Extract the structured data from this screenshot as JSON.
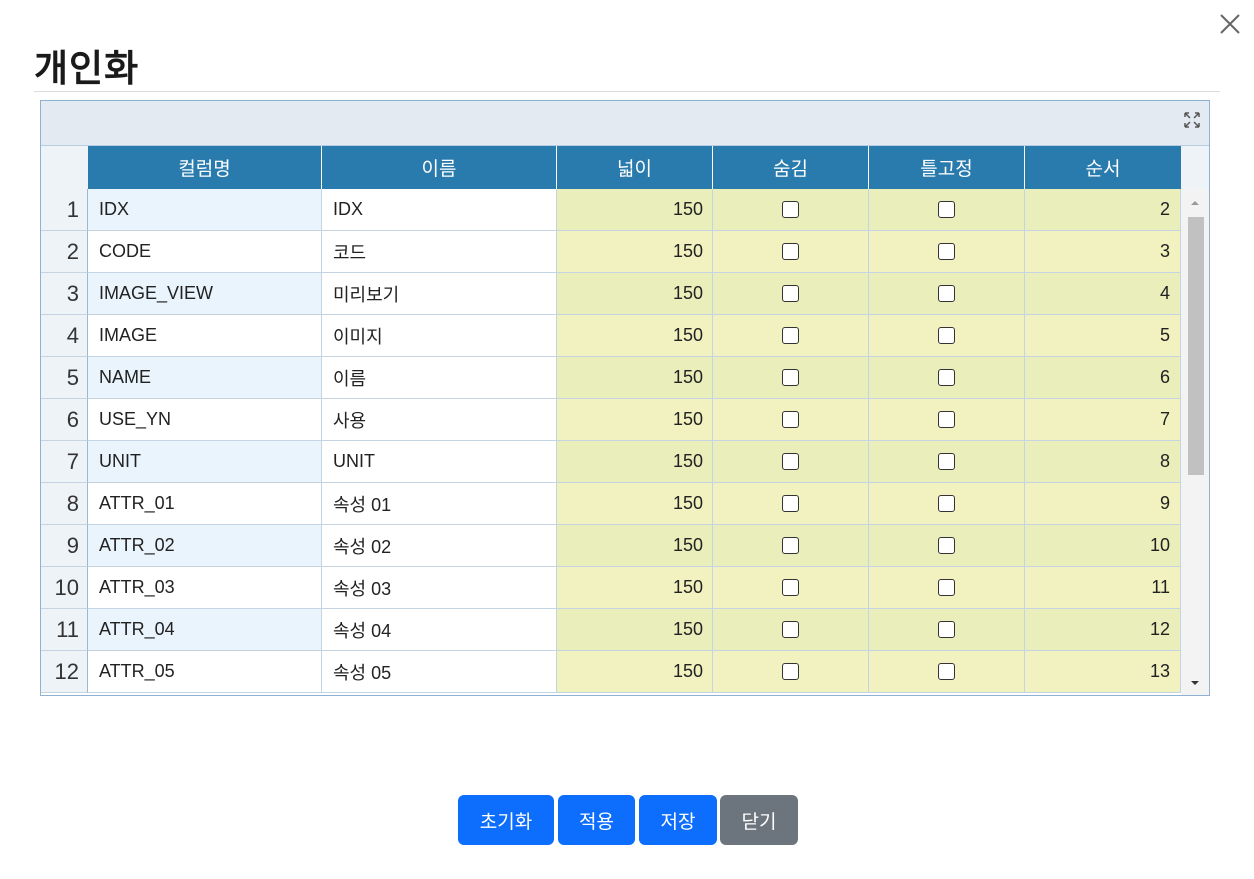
{
  "dialog": {
    "title": "개인화"
  },
  "grid": {
    "columns": [
      "컬럼명",
      "이름",
      "넓이",
      "숨김",
      "틀고정",
      "순서"
    ],
    "rows": [
      {
        "num": "1",
        "column": "IDX",
        "name": "IDX",
        "width": "150",
        "hidden": false,
        "frozen": false,
        "order": "2"
      },
      {
        "num": "2",
        "column": "CODE",
        "name": "코드",
        "width": "150",
        "hidden": false,
        "frozen": false,
        "order": "3"
      },
      {
        "num": "3",
        "column": "IMAGE_VIEW",
        "name": "미리보기",
        "width": "150",
        "hidden": false,
        "frozen": false,
        "order": "4"
      },
      {
        "num": "4",
        "column": "IMAGE",
        "name": "이미지",
        "width": "150",
        "hidden": false,
        "frozen": false,
        "order": "5"
      },
      {
        "num": "5",
        "column": "NAME",
        "name": "이름",
        "width": "150",
        "hidden": false,
        "frozen": false,
        "order": "6"
      },
      {
        "num": "6",
        "column": "USE_YN",
        "name": "사용",
        "width": "150",
        "hidden": false,
        "frozen": false,
        "order": "7"
      },
      {
        "num": "7",
        "column": "UNIT",
        "name": "UNIT",
        "width": "150",
        "hidden": false,
        "frozen": false,
        "order": "8"
      },
      {
        "num": "8",
        "column": "ATTR_01",
        "name": "속성 01",
        "width": "150",
        "hidden": false,
        "frozen": false,
        "order": "9"
      },
      {
        "num": "9",
        "column": "ATTR_02",
        "name": "속성 02",
        "width": "150",
        "hidden": false,
        "frozen": false,
        "order": "10"
      },
      {
        "num": "10",
        "column": "ATTR_03",
        "name": "속성 03",
        "width": "150",
        "hidden": false,
        "frozen": false,
        "order": "11"
      },
      {
        "num": "11",
        "column": "ATTR_04",
        "name": "속성 04",
        "width": "150",
        "hidden": false,
        "frozen": false,
        "order": "12"
      },
      {
        "num": "12",
        "column": "ATTR_05",
        "name": "속성 05",
        "width": "150",
        "hidden": false,
        "frozen": false,
        "order": "13"
      }
    ]
  },
  "buttons": {
    "reset": "초기화",
    "apply": "적용",
    "save": "저장",
    "close": "닫기"
  },
  "icons": {
    "close": "close-icon",
    "expand": "expand-icon",
    "scroll_up": "caret-up-icon",
    "scroll_down": "caret-down-icon"
  },
  "colors": {
    "header_bg": "#2a7bad",
    "primary": "#0d6efd",
    "secondary": "#6c757d",
    "editable_cell": "#f1f2bf"
  }
}
